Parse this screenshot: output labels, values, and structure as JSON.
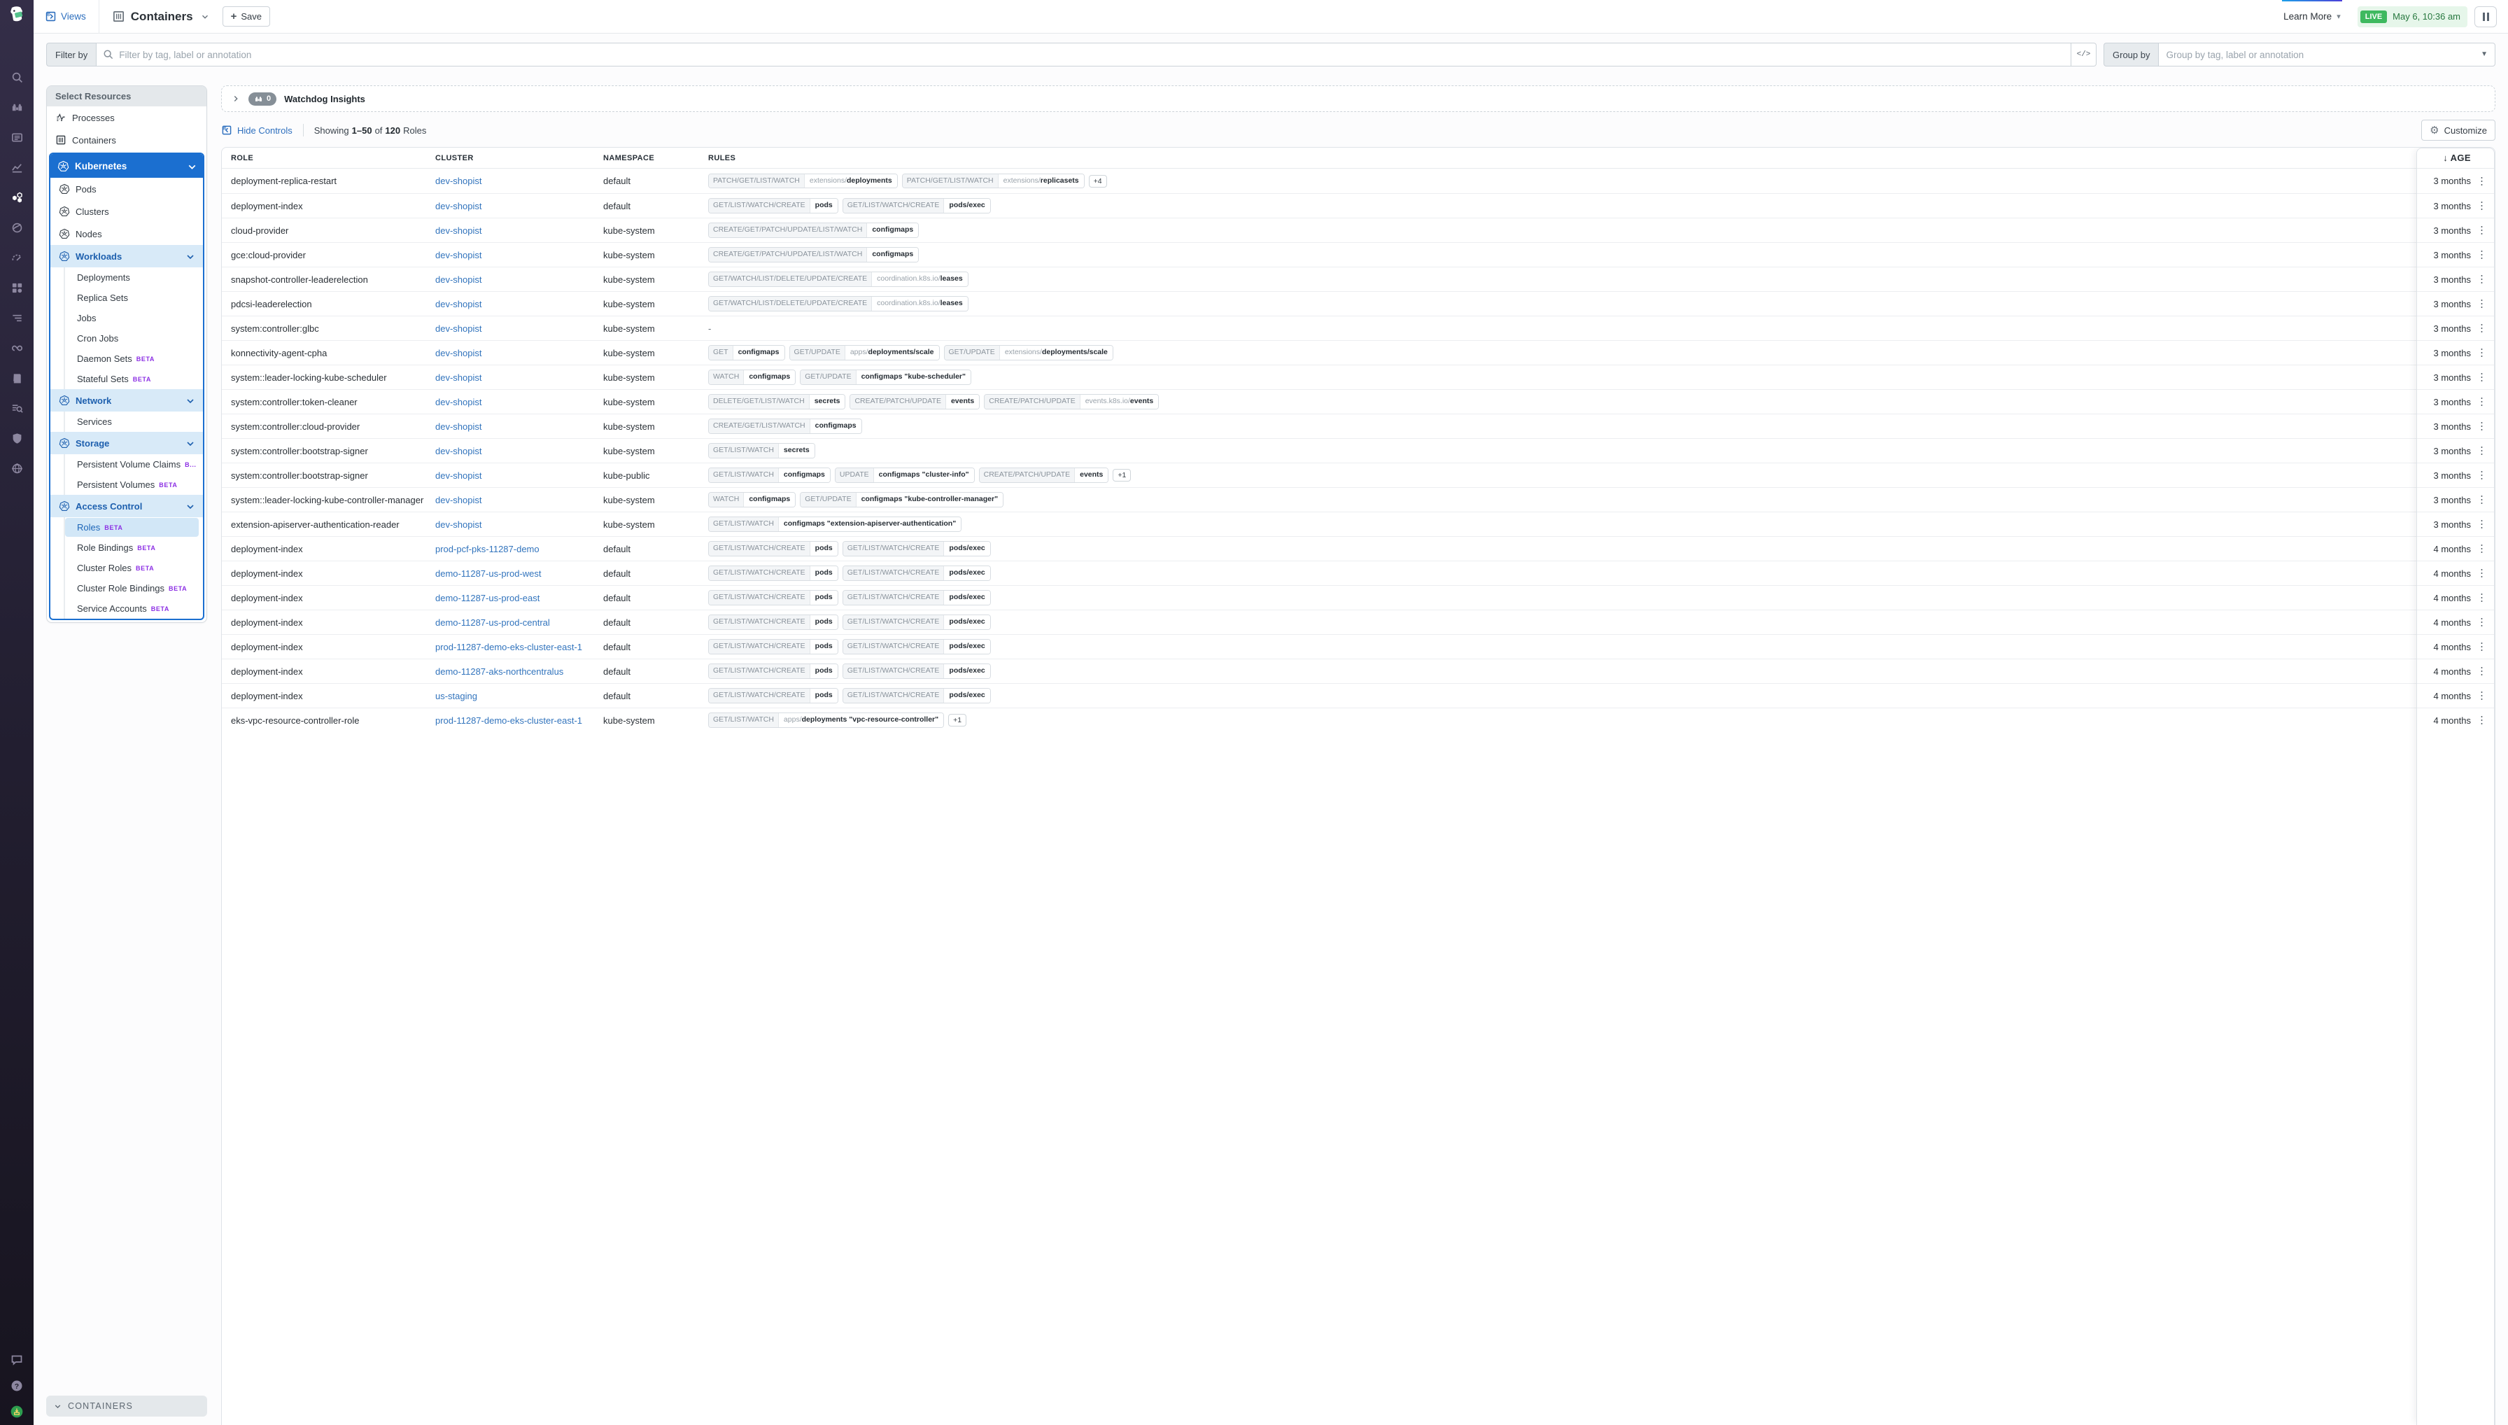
{
  "topbar": {
    "views_label": "Views",
    "title": "Containers",
    "save_label": "Save",
    "learn_more_label": "Learn More",
    "live_badge": "LIVE",
    "live_time": "May 6, 10:36 am"
  },
  "filterbar": {
    "filter_label": "Filter by",
    "filter_placeholder": "Filter by tag, label or annotation",
    "code_toggle": "</>",
    "group_label": "Group by",
    "group_placeholder": "Group by tag, label or annotation"
  },
  "icons": {
    "gear": "⚙",
    "caret_down": "▾",
    "kebab": "⋮",
    "dash": "-",
    "arrow_down": "↓",
    "plus": "+"
  },
  "colors": {
    "accent_blue": "#1b6fd0",
    "link_blue": "#3274bd",
    "beta_purple": "#8c2fe4",
    "live_green": "#3eb95f",
    "subsection_bg": "#d8eaf8"
  },
  "rail": {
    "items": [
      "search",
      "watchdog",
      "logs",
      "metrics",
      "containers",
      "apm",
      "dashboards",
      "integrations",
      "monitors",
      "pipelines",
      "notebooks",
      "audit",
      "security",
      "network"
    ],
    "active": "containers",
    "bottom": [
      "chat",
      "help",
      "avatar"
    ]
  },
  "sidebar": {
    "header": "Select Resources",
    "top_items": [
      {
        "label": "Processes",
        "icon": "processes"
      },
      {
        "label": "Containers",
        "icon": "grid"
      }
    ],
    "kubernetes": {
      "label": "Kubernetes",
      "entries": [
        {
          "t": "k8s-item",
          "label": "Pods"
        },
        {
          "t": "k8s-item",
          "label": "Clusters"
        },
        {
          "t": "k8s-item",
          "label": "Nodes"
        },
        {
          "t": "subsection",
          "label": "Workloads"
        },
        {
          "t": "child",
          "label": "Deployments"
        },
        {
          "t": "child",
          "label": "Replica Sets"
        },
        {
          "t": "child",
          "label": "Jobs"
        },
        {
          "t": "child",
          "label": "Cron Jobs"
        },
        {
          "t": "child",
          "label": "Daemon Sets",
          "beta": "BETA"
        },
        {
          "t": "child",
          "label": "Stateful Sets",
          "beta": "BETA"
        },
        {
          "t": "subsection",
          "label": "Network"
        },
        {
          "t": "child",
          "label": "Services"
        },
        {
          "t": "subsection",
          "label": "Storage"
        },
        {
          "t": "child",
          "label": "Persistent Volume Claims",
          "beta": "B..."
        },
        {
          "t": "child",
          "label": "Persistent Volumes",
          "beta": "BETA"
        },
        {
          "t": "subsection",
          "label": "Access Control"
        },
        {
          "t": "child",
          "label": "Roles",
          "beta": "BETA",
          "selected": true
        },
        {
          "t": "child",
          "label": "Role Bindings",
          "beta": "BETA"
        },
        {
          "t": "child",
          "label": "Cluster Roles",
          "beta": "BETA"
        },
        {
          "t": "child",
          "label": "Cluster Role Bindings",
          "beta": "BETA"
        },
        {
          "t": "child",
          "label": "Service Accounts",
          "beta": "BETA"
        }
      ]
    },
    "bottom_section_label": "CONTAINERS"
  },
  "main": {
    "watchdog": {
      "title": "Watchdog Insights",
      "count": "0"
    },
    "controls": {
      "hide_label": "Hide Controls",
      "showing_prefix": "Showing",
      "range": "1–50",
      "of_word": "of",
      "total": "120",
      "unit": "Roles",
      "customize_label": "Customize"
    },
    "table": {
      "columns": {
        "role": "ROLE",
        "cluster": "CLUSTER",
        "namespace": "NAMESPACE",
        "rules": "RULES",
        "age": "AGE"
      },
      "rows": [
        {
          "role": "deployment-replica-restart",
          "cluster": "dev-shopist",
          "namespace": "default",
          "age": "3 months",
          "rules": [
            {
              "v": "PATCH/GET/LIST/WATCH",
              "p": "extensions/",
              "r": "deployments"
            },
            {
              "v": "PATCH/GET/LIST/WATCH",
              "p": "extensions/",
              "r": "replicasets"
            },
            {
              "more": "+4"
            }
          ]
        },
        {
          "role": "deployment-index",
          "cluster": "dev-shopist",
          "namespace": "default",
          "age": "3 months",
          "rules": [
            {
              "v": "GET/LIST/WATCH/CREATE",
              "p": "",
              "r": "pods"
            },
            {
              "v": "GET/LIST/WATCH/CREATE",
              "p": "",
              "r": "pods/exec"
            }
          ]
        },
        {
          "role": "cloud-provider",
          "cluster": "dev-shopist",
          "namespace": "kube-system",
          "age": "3 months",
          "rules": [
            {
              "v": "CREATE/GET/PATCH/UPDATE/LIST/WATCH",
              "p": "",
              "r": "configmaps"
            }
          ]
        },
        {
          "role": "gce:cloud-provider",
          "cluster": "dev-shopist",
          "namespace": "kube-system",
          "age": "3 months",
          "rules": [
            {
              "v": "CREATE/GET/PATCH/UPDATE/LIST/WATCH",
              "p": "",
              "r": "configmaps"
            }
          ]
        },
        {
          "role": "snapshot-controller-leaderelection",
          "cluster": "dev-shopist",
          "namespace": "kube-system",
          "age": "3 months",
          "rules": [
            {
              "v": "GET/WATCH/LIST/DELETE/UPDATE/CREATE",
              "p": "coordination.k8s.io/",
              "r": "leases"
            }
          ]
        },
        {
          "role": "pdcsi-leaderelection",
          "cluster": "dev-shopist",
          "namespace": "kube-system",
          "age": "3 months",
          "rules": [
            {
              "v": "GET/WATCH/LIST/DELETE/UPDATE/CREATE",
              "p": "coordination.k8s.io/",
              "r": "leases"
            }
          ]
        },
        {
          "role": "system:controller:glbc",
          "cluster": "dev-shopist",
          "namespace": "kube-system",
          "age": "3 months",
          "rules": null
        },
        {
          "role": "konnectivity-agent-cpha",
          "cluster": "dev-shopist",
          "namespace": "kube-system",
          "age": "3 months",
          "rules": [
            {
              "v": "GET",
              "p": "",
              "r": "configmaps"
            },
            {
              "v": "GET/UPDATE",
              "p": "apps/",
              "r": "deployments/scale"
            },
            {
              "v": "GET/UPDATE",
              "p": "extensions/",
              "r": "deployments/scale"
            }
          ]
        },
        {
          "role": "system::leader-locking-kube-scheduler",
          "cluster": "dev-shopist",
          "namespace": "kube-system",
          "age": "3 months",
          "rules": [
            {
              "v": "WATCH",
              "p": "",
              "r": "configmaps"
            },
            {
              "v": "GET/UPDATE",
              "p": "",
              "r": "configmaps \"kube-scheduler\""
            }
          ]
        },
        {
          "role": "system:controller:token-cleaner",
          "cluster": "dev-shopist",
          "namespace": "kube-system",
          "age": "3 months",
          "rules": [
            {
              "v": "DELETE/GET/LIST/WATCH",
              "p": "",
              "r": "secrets"
            },
            {
              "v": "CREATE/PATCH/UPDATE",
              "p": "",
              "r": "events"
            },
            {
              "v": "CREATE/PATCH/UPDATE",
              "p": "events.k8s.io/",
              "r": "events"
            }
          ]
        },
        {
          "role": "system:controller:cloud-provider",
          "cluster": "dev-shopist",
          "namespace": "kube-system",
          "age": "3 months",
          "rules": [
            {
              "v": "CREATE/GET/LIST/WATCH",
              "p": "",
              "r": "configmaps"
            }
          ]
        },
        {
          "role": "system:controller:bootstrap-signer",
          "cluster": "dev-shopist",
          "namespace": "kube-system",
          "age": "3 months",
          "rules": [
            {
              "v": "GET/LIST/WATCH",
              "p": "",
              "r": "secrets"
            }
          ]
        },
        {
          "role": "system:controller:bootstrap-signer",
          "cluster": "dev-shopist",
          "namespace": "kube-public",
          "age": "3 months",
          "rules": [
            {
              "v": "GET/LIST/WATCH",
              "p": "",
              "r": "configmaps"
            },
            {
              "v": "UPDATE",
              "p": "",
              "r": "configmaps \"cluster-info\""
            },
            {
              "v": "CREATE/PATCH/UPDATE",
              "p": "",
              "r": "events"
            },
            {
              "more": "+1"
            }
          ]
        },
        {
          "role": "system::leader-locking-kube-controller-manager",
          "cluster": "dev-shopist",
          "namespace": "kube-system",
          "age": "3 months",
          "rules": [
            {
              "v": "WATCH",
              "p": "",
              "r": "configmaps"
            },
            {
              "v": "GET/UPDATE",
              "p": "",
              "r": "configmaps \"kube-controller-manager\""
            }
          ]
        },
        {
          "role": "extension-apiserver-authentication-reader",
          "cluster": "dev-shopist",
          "namespace": "kube-system",
          "age": "3 months",
          "rules": [
            {
              "v": "GET/LIST/WATCH",
              "p": "",
              "r": "configmaps \"extension-apiserver-authentication\""
            }
          ]
        },
        {
          "role": "deployment-index",
          "cluster": "prod-pcf-pks-11287-demo",
          "namespace": "default",
          "age": "4 months",
          "rules": [
            {
              "v": "GET/LIST/WATCH/CREATE",
              "p": "",
              "r": "pods"
            },
            {
              "v": "GET/LIST/WATCH/CREATE",
              "p": "",
              "r": "pods/exec"
            }
          ]
        },
        {
          "role": "deployment-index",
          "cluster": "demo-11287-us-prod-west",
          "namespace": "default",
          "age": "4 months",
          "rules": [
            {
              "v": "GET/LIST/WATCH/CREATE",
              "p": "",
              "r": "pods"
            },
            {
              "v": "GET/LIST/WATCH/CREATE",
              "p": "",
              "r": "pods/exec"
            }
          ]
        },
        {
          "role": "deployment-index",
          "cluster": "demo-11287-us-prod-east",
          "namespace": "default",
          "age": "4 months",
          "rules": [
            {
              "v": "GET/LIST/WATCH/CREATE",
              "p": "",
              "r": "pods"
            },
            {
              "v": "GET/LIST/WATCH/CREATE",
              "p": "",
              "r": "pods/exec"
            }
          ]
        },
        {
          "role": "deployment-index",
          "cluster": "demo-11287-us-prod-central",
          "namespace": "default",
          "age": "4 months",
          "rules": [
            {
              "v": "GET/LIST/WATCH/CREATE",
              "p": "",
              "r": "pods"
            },
            {
              "v": "GET/LIST/WATCH/CREATE",
              "p": "",
              "r": "pods/exec"
            }
          ]
        },
        {
          "role": "deployment-index",
          "cluster": "prod-11287-demo-eks-cluster-east-1",
          "namespace": "default",
          "age": "4 months",
          "rules": [
            {
              "v": "GET/LIST/WATCH/CREATE",
              "p": "",
              "r": "pods"
            },
            {
              "v": "GET/LIST/WATCH/CREATE",
              "p": "",
              "r": "pods/exec"
            }
          ]
        },
        {
          "role": "deployment-index",
          "cluster": "demo-11287-aks-northcentralus",
          "namespace": "default",
          "age": "4 months",
          "rules": [
            {
              "v": "GET/LIST/WATCH/CREATE",
              "p": "",
              "r": "pods"
            },
            {
              "v": "GET/LIST/WATCH/CREATE",
              "p": "",
              "r": "pods/exec"
            }
          ]
        },
        {
          "role": "deployment-index",
          "cluster": "us-staging",
          "namespace": "default",
          "age": "4 months",
          "rules": [
            {
              "v": "GET/LIST/WATCH/CREATE",
              "p": "",
              "r": "pods"
            },
            {
              "v": "GET/LIST/WATCH/CREATE",
              "p": "",
              "r": "pods/exec"
            }
          ]
        },
        {
          "role": "eks-vpc-resource-controller-role",
          "cluster": "prod-11287-demo-eks-cluster-east-1",
          "namespace": "kube-system",
          "age": "4 months",
          "partial": true,
          "rules": [
            {
              "v": "GET/LIST/WATCH",
              "p": "apps/",
              "r": "deployments \"vpc-resource-controller\""
            },
            {
              "more": "+1"
            }
          ]
        }
      ]
    }
  }
}
